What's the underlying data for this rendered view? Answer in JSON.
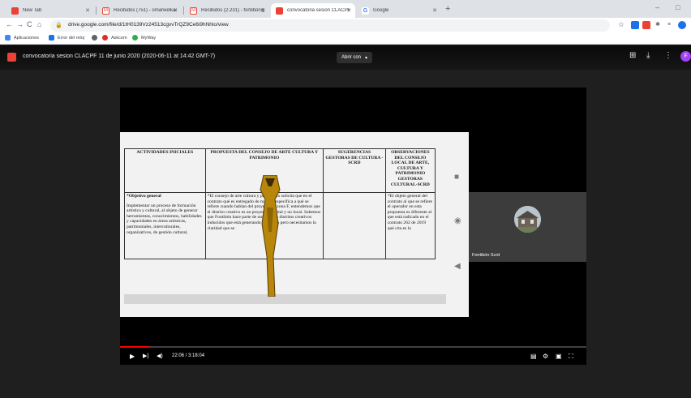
{
  "tabs": [
    {
      "title": "New Tab",
      "color": "#ea4335",
      "active": false
    },
    {
      "title": "Recibidos (751) - omarwelkama ·",
      "color": "#ea4335",
      "active": false
    },
    {
      "title": "Recibidos (2.231) - fontibon@sc",
      "color": "#ea4335",
      "active": false
    },
    {
      "title": "convocatoria sesion CLACPF 11 ·",
      "color": "#ea4335",
      "active": true
    },
    {
      "title": "Google",
      "color": "#4285f4",
      "active": false
    }
  ],
  "window": {
    "new_tab": "+",
    "minimize": "–",
    "maximize": "□"
  },
  "toolbar": {
    "back": "←",
    "forward": "→",
    "reload": "C",
    "home": "⌂",
    "url": "drive.google.com/file/d/1tH0139Vz24513cgvvTrQZ9Ce6i9hNhlo/view",
    "star": "☆"
  },
  "bookmarks": [
    {
      "label": "Aplicaciones",
      "color": "#4285f4"
    },
    {
      "label": "Error del reloj",
      "color": "#1a73e8"
    },
    {
      "label": "",
      "color": "#5f6368"
    },
    {
      "label": "Askcom",
      "color": "#d93025"
    },
    {
      "label": "MyWay",
      "color": "#34a853"
    }
  ],
  "viewer": {
    "file_title": "convocatoria sesion CLACPF 11 de junio 2020 (2020-06-11 at 14:42 GMT-7)",
    "open_with": "Abrir con",
    "open_with_caret": "▾",
    "actions": [
      "⊞",
      "⤓",
      "⋮"
    ],
    "avatar_letter": "F"
  },
  "slide": {
    "headers": [
      "ACTIVIDADES INICIALES",
      "PROPUESTA DEL CONSEJO DE ARTE CULTURA Y PATRIMONIO",
      "SUGERENCIAS GESTORAS DE CULTURA -SCRD",
      "OBSERVACIONES DEL CONSEJO LOCAL DE ARTE, CULTURA Y PATRIMONIO GESTORAS CULTURAL-SCRD"
    ],
    "row_title": "*Objetivo general",
    "row_col1": "Implementar un proceso de formación artística y cultural, al objeto de generar herramientas, conocimientos, habilidades y capacidades en áreas artísticas, patrimoniales, interculturales, organizativos, de gestión cultural,",
    "row_col2": "*El consejo de arte cultura y patrimonio solicita que en el contrato qué es entregado de manera específica a qué se refiere cuando hablan del proyecto de zona F, entendemos que el distrito creativo es un proyecto distrital y no local. Sabemos que Fontibón hace parte de uno los dos distritos creativos inducidos que está generando el distrito pero necesitamos la claridad que se",
    "row_col3": "",
    "row_col4": "*El objeto general del contrato al que se refiere el operador en esta propuesta es diferente al que está radicado en el contrato 262 de 2019 qué cita es la",
    "side_controls": [
      "■",
      "◉",
      "◀"
    ]
  },
  "participant": {
    "name": "Fontibón Scrd"
  },
  "player": {
    "progress": 0.063,
    "time": "22:06 / 3:18:04",
    "play": "▶",
    "next": "▶|",
    "volume": "◀)",
    "subtitles": "▤",
    "settings": "⚙",
    "miniplayer": "▣",
    "fullscreen": "⛶"
  }
}
